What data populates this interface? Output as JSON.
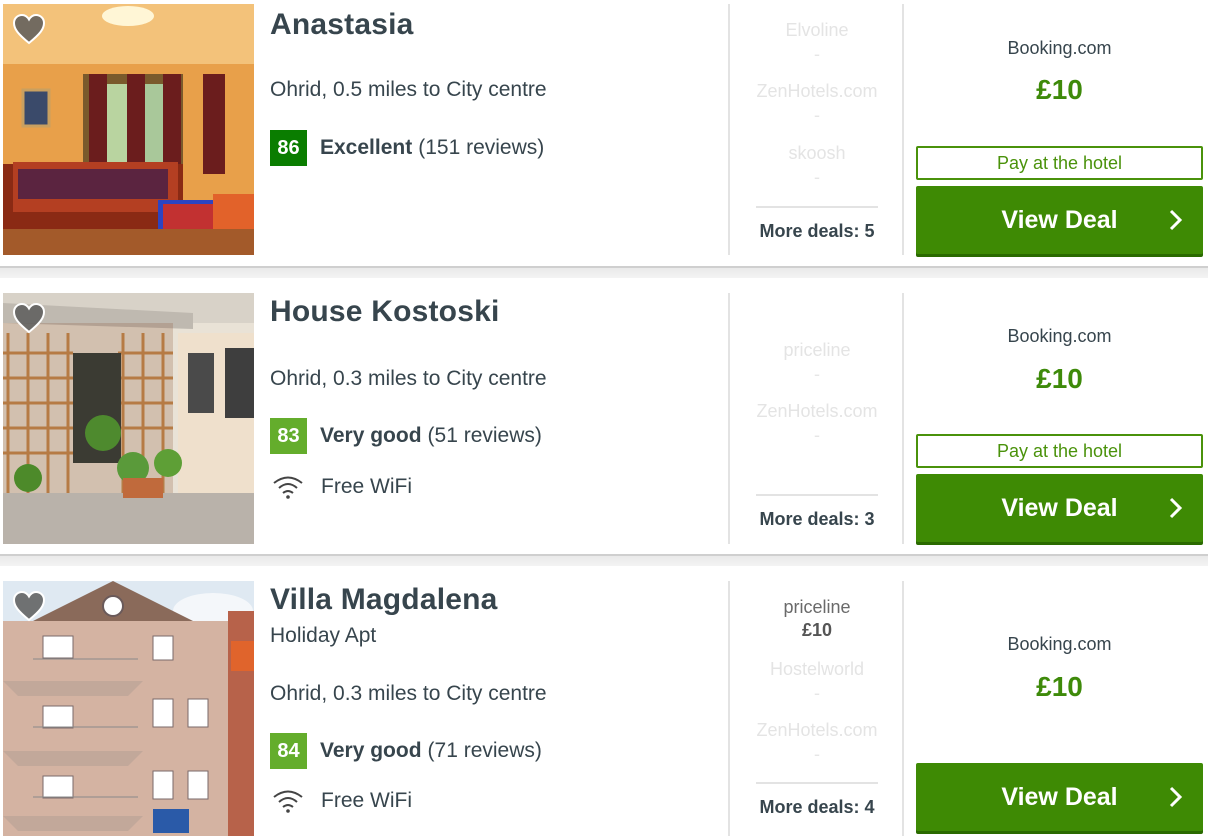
{
  "colors": {
    "excellent": "#0a7d00",
    "very_good": "#64ad2c",
    "cta": "#3e8a04",
    "price": "#3e8a0a"
  },
  "hotels": [
    {
      "name": "Anastasia",
      "subtype": "",
      "location": "Ohrid, 0.5 miles to City centre",
      "score": "86",
      "rating_word": "Excellent",
      "reviews": "(151 reviews)",
      "amenity": "",
      "alt_deals": [
        {
          "provider": "Elvoline",
          "price": "-"
        },
        {
          "provider": "ZenHotels.com",
          "price": "-"
        },
        {
          "provider": "skoosh",
          "price": "-"
        }
      ],
      "more_deals": "More deals: 5",
      "best_site": "Booking.com",
      "best_price": "£10",
      "pay_label": "Pay at the hotel",
      "cta": "View Deal"
    },
    {
      "name": "House Kostoski",
      "subtype": "",
      "location": "Ohrid, 0.3 miles to City centre",
      "score": "83",
      "rating_word": "Very good",
      "reviews": "(51 reviews)",
      "amenity": "Free WiFi",
      "alt_deals": [
        {
          "provider": "priceline",
          "price": "-"
        },
        {
          "provider": "ZenHotels.com",
          "price": "-"
        }
      ],
      "more_deals": "More deals: 3",
      "best_site": "Booking.com",
      "best_price": "£10",
      "pay_label": "Pay at the hotel",
      "cta": "View Deal"
    },
    {
      "name": "Villa Magdalena",
      "subtype": "Holiday Apt",
      "location": "Ohrid, 0.3 miles to City centre",
      "score": "84",
      "rating_word": "Very good",
      "reviews": "(71 reviews)",
      "amenity": "Free WiFi",
      "alt_deals": [
        {
          "provider": "priceline",
          "price": "£10"
        },
        {
          "provider": "Hostelworld",
          "price": "-"
        },
        {
          "provider": "ZenHotels.com",
          "price": "-"
        }
      ],
      "more_deals": "More deals: 4",
      "best_site": "Booking.com",
      "best_price": "£10",
      "pay_label": "",
      "cta": "View Deal"
    }
  ]
}
